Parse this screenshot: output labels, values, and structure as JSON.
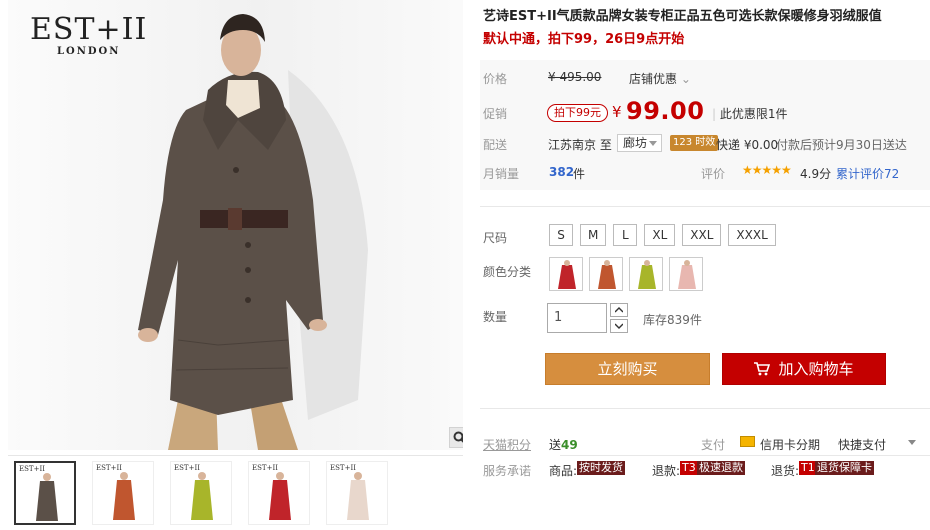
{
  "brand": {
    "mark": "EST+II",
    "city": "LONDON"
  },
  "title": "艺诗EST+II气质款品牌女装专柜正品五色可选长款保暖修身羽绒服值",
  "subtitle": "默认中通，拍下99，26日9点开始",
  "price": {
    "label": "价格",
    "original": "¥ 495.00",
    "shop_discount": "店铺优惠"
  },
  "promo": {
    "label": "促销",
    "tag": "拍下99元",
    "currency": "¥",
    "value": "99.00",
    "limit": "此优惠限1件"
  },
  "shipping": {
    "label": "配送",
    "from": "江苏南京  至",
    "to": "廊坊",
    "fast_badge": "123 时效",
    "fee": "快递 ¥0.00",
    "eta": "付款后预计9月30日送达"
  },
  "sales": {
    "label": "月销量",
    "count": "382",
    "unit": "件",
    "rating_label": "评价",
    "stars": "★★★★★",
    "score": "4.9分",
    "reviews": "累计评价72"
  },
  "size": {
    "label": "尺码",
    "options": [
      "S",
      "M",
      "L",
      "XL",
      "XXL",
      "XXXL"
    ]
  },
  "color": {
    "label": "颜色分类",
    "swatches": [
      "#c0242a",
      "#c0562f",
      "#a8b52a",
      "#e8b7b0"
    ]
  },
  "quantity": {
    "label": "数量",
    "value": "1",
    "stock": "库存839件"
  },
  "buttons": {
    "buy": "立刻购买",
    "cart": "加入购物车"
  },
  "points": {
    "label": "天猫积分",
    "prefix": "送",
    "value": "49"
  },
  "payment": {
    "label": "支付",
    "card": "信用卡分期",
    "quick": "快捷支付"
  },
  "promise": {
    "label": "服务承诺",
    "goods": "商品:",
    "goods_badge": "按时发货",
    "refund": "退款:",
    "refund_tag": "T3",
    "refund_badge": "极速退款",
    "return": "退货:",
    "return_tag": "T1",
    "return_badge": "退货保障卡"
  },
  "thumbnails": [
    "#5b5048",
    "#c0562f",
    "#a8b52a",
    "#c0242a",
    "#e8d7cc"
  ]
}
